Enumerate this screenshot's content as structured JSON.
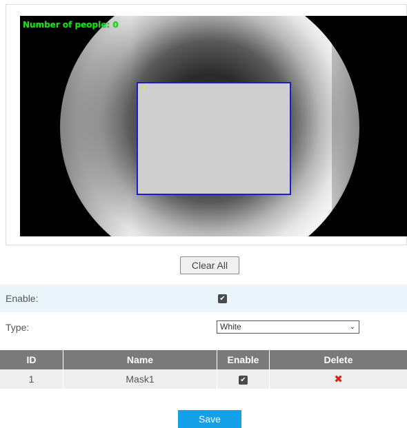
{
  "video": {
    "people_count": "Number of people: 0",
    "mask_label": "1"
  },
  "buttons": {
    "clear_all": "Clear All",
    "save": "Save"
  },
  "settings": {
    "enable_label": "Enable:",
    "enable_checked": true,
    "type_label": "Type:",
    "type_value": "White"
  },
  "table": {
    "headers": [
      "ID",
      "Name",
      "Enable",
      "Delete"
    ],
    "rows": [
      {
        "id": "1",
        "name": "Mask1",
        "enable": true
      }
    ]
  },
  "icons": {
    "check": "checkmark-icon",
    "delete": "delete-icon",
    "dropdown": "chevron-down-icon"
  },
  "colors": {
    "accent": "#14a0e8",
    "table_header": "#7a7a7a",
    "delete": "#d9261c",
    "mask_border": "#1c1ccc",
    "overlay_text": "#1adb1a"
  }
}
